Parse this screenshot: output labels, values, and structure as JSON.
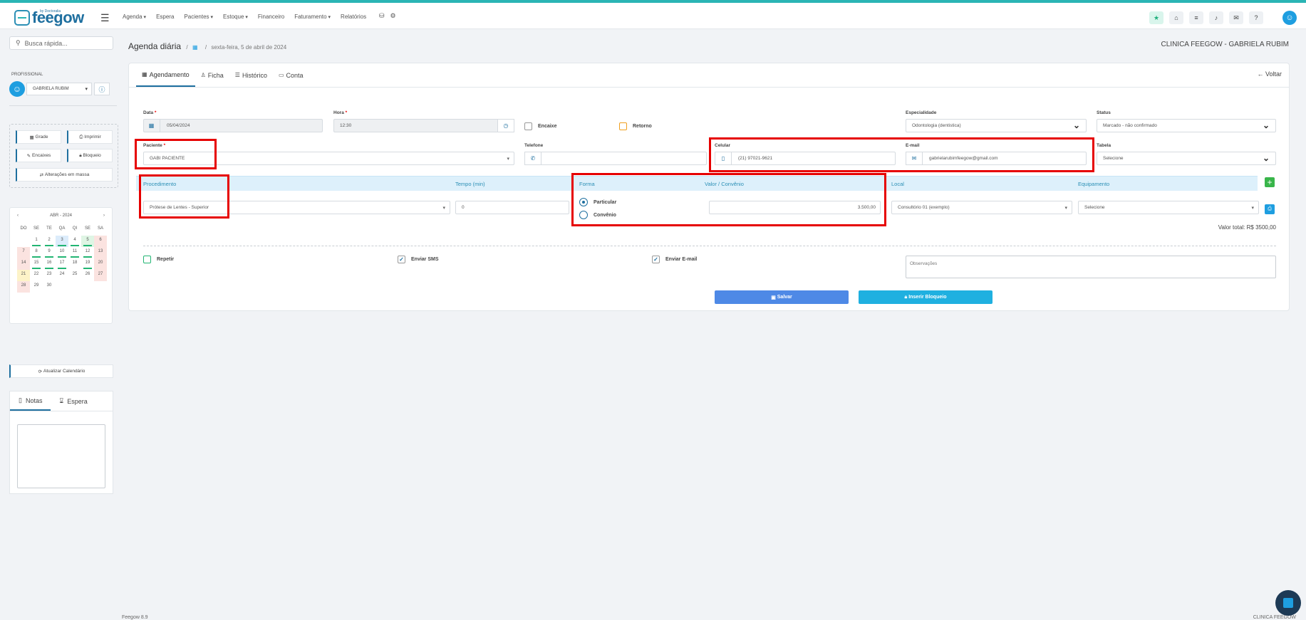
{
  "header": {
    "logo_text": "feegow",
    "logo_sub": "by Doctoralia",
    "nav": [
      {
        "label": "Agenda",
        "dropdown": true
      },
      {
        "label": "Espera",
        "dropdown": false
      },
      {
        "label": "Pacientes",
        "dropdown": true
      },
      {
        "label": "Estoque",
        "dropdown": true
      },
      {
        "label": "Financeiro",
        "dropdown": false
      },
      {
        "label": "Faturamento",
        "dropdown": true
      },
      {
        "label": "Relatórios",
        "dropdown": false
      }
    ]
  },
  "sidebar": {
    "search_placeholder": "Busca rápida...",
    "profissional_label": "PROFISSIONAL",
    "profissional_value": "GABRIELA RUBIM",
    "buttons": {
      "grade": "Grade",
      "imprimir": "Imprimir",
      "encaixes": "Encaixes",
      "bloqueio": "Bloqueio",
      "alteracoes": "Alterações em massa"
    },
    "calendar": {
      "month": "ABR - 2024",
      "days_header": [
        "DO",
        "SE",
        "TE",
        "QA",
        "QI",
        "SE",
        "SA"
      ]
    },
    "update_button": "Atualizar Calendário",
    "tabs": {
      "notas": "Notas",
      "espera": "Espera"
    }
  },
  "page": {
    "title": "Agenda diária",
    "date": "sexta-feira, 5 de abril de 2024",
    "clinic": "CLINICA FEEGOW - GABRIELA RUBIM"
  },
  "tabs": {
    "agendamento": "Agendamento",
    "ficha": "Ficha",
    "historico": "Histórico",
    "conta": "Conta",
    "voltar": "Voltar"
  },
  "form": {
    "data_label": "Data",
    "data_value": "05/04/2024",
    "hora_label": "Hora",
    "hora_value": "12:30",
    "encaixe": "Encaixe",
    "retorno": "Retorno",
    "especialidade_label": "Especialidade",
    "especialidade_value": "Odontologia (dentistica)",
    "status_label": "Status",
    "status_value": "Marcado - não confirmado",
    "paciente_label": "Paciente",
    "paciente_value": "GABI PACIENTE",
    "telefone_label": "Telefone",
    "celular_label": "Celular",
    "celular_value": "(21) 97021-9621",
    "email_label": "E-mail",
    "email_value": "gabrielarubimfeegow@gmail.com",
    "tabela_label": "Tabela",
    "tabela_value": "Selecione"
  },
  "procedure": {
    "headers": {
      "procedimento": "Procedimento",
      "tempo": "Tempo (min)",
      "forma": "Forma",
      "valor": "Valor / Convênio",
      "local": "Local",
      "equipamento": "Equipamento"
    },
    "procedimento_value": "Prótese de Lentes - Superior",
    "tempo_value": "0",
    "forma_particular": "Particular",
    "forma_convenio": "Convênio",
    "valor_value": "3.500,00",
    "local_value": "Consultório 01 (exemplo)",
    "equipamento_value": "Selecione",
    "total": "Valor total: R$ 3500,00"
  },
  "options": {
    "repetir": "Repetir",
    "sms": "Enviar SMS",
    "email": "Enviar E-mail",
    "obs_placeholder": "Observações"
  },
  "actions": {
    "salvar": "Salvar",
    "bloqueio": "Inserir Bloqueio"
  },
  "footer": {
    "version": "Feegow 8.9",
    "clinic": "CLINICA FEEGOW"
  }
}
